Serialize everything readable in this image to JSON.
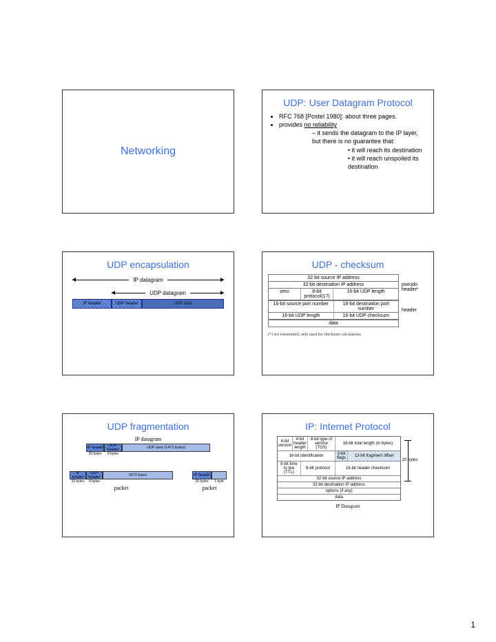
{
  "page_number": "1",
  "slides": {
    "s1": {
      "title": "Networking"
    },
    "s2": {
      "title": "UDP: User Datagram Protocol",
      "b1": "RFC 768 [Postel 1980]: about three pages.",
      "b2_pre": "provides ",
      "b2_u": "no reliability",
      "b2a": "it sends the datagram to the IP layer, but there is no guarantee that:",
      "b2a1": "it will reach its destination",
      "b2a2": "it will reach unspoiled its destination"
    },
    "s3": {
      "title": "UDP encapsulation",
      "ip_datagram": "IP datagram",
      "udp_datagram": "UDP datagram",
      "ip_header": "IP header",
      "udp_header": "UDP header",
      "udp_data": "UDP data"
    },
    "s4": {
      "title": "UDP - checksum",
      "r1": "32-bit source IP address",
      "r2": "32-bit destination IP address",
      "r3a": "zero",
      "r3b": "8-bit protocol(17)",
      "r3c": "16-bit UDP length",
      "r4a": "16-bit source port number",
      "r4b": "16-bit destination port number",
      "r5a": "16-bit UDP length",
      "r5b": "16-bit UDP checksum",
      "r6": "data",
      "side1": "pseudo header*",
      "side2": "header",
      "footnote": "(*) not transmitted, only used for checksum calculations"
    },
    "s5": {
      "title": "UDP fragmentation",
      "ip_datagram": "IP datagram",
      "ip_header": "IP header",
      "udp_header": "UDP header",
      "udp_data": "UDP data (1473 bytes)",
      "b20": "20 bytes",
      "b8": "8 bytes",
      "f1472": "1472 bytes",
      "b1": "1 byte",
      "packet": "packet"
    },
    "s6": {
      "title": "IP: Internet Protocol",
      "r1a": "4-bit version",
      "r1b": "4-bit header length",
      "r1c": "8-bit type of service (TOS)",
      "r1d": "16-bit total length (in bytes)",
      "r2a": "16-bit identification",
      "r2b": "3-bit flags",
      "r2c": "13-bit fragment offset",
      "r3a": "8-bit time to live (TTL)",
      "r3b": "8-bit protocol",
      "r3c": "16-bit header checksum",
      "r4": "32-bit source IP address",
      "r5": "32-bit destination IP address",
      "r6": "options (if any)",
      "r7": "data",
      "side": "20 bytes",
      "caption": "IP Datagram"
    }
  }
}
